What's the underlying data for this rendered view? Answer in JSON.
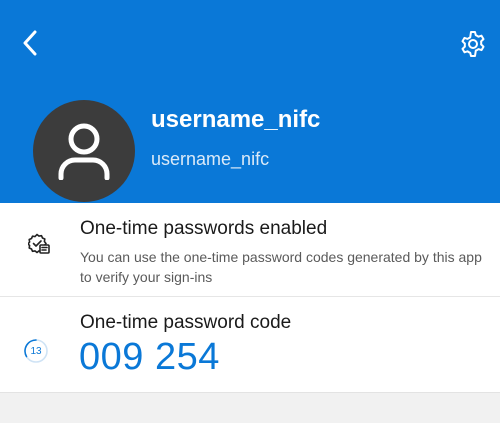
{
  "header": {
    "back_icon": "chevron-left-icon",
    "settings_icon": "gear-icon",
    "background_color": "#0a78d7"
  },
  "account": {
    "display_name": "username_nifc",
    "username": "username_nifc",
    "avatar_icon": "person-icon"
  },
  "otp_status": {
    "icon": "checkmark-badge-icon",
    "title": "One-time passwords enabled",
    "description": "You can use the one-time password codes generated by this app to verify your sign-ins"
  },
  "otp_code": {
    "title": "One-time password code",
    "code": "009 254",
    "seconds_remaining": "13",
    "accent_color": "#0a78d7"
  }
}
